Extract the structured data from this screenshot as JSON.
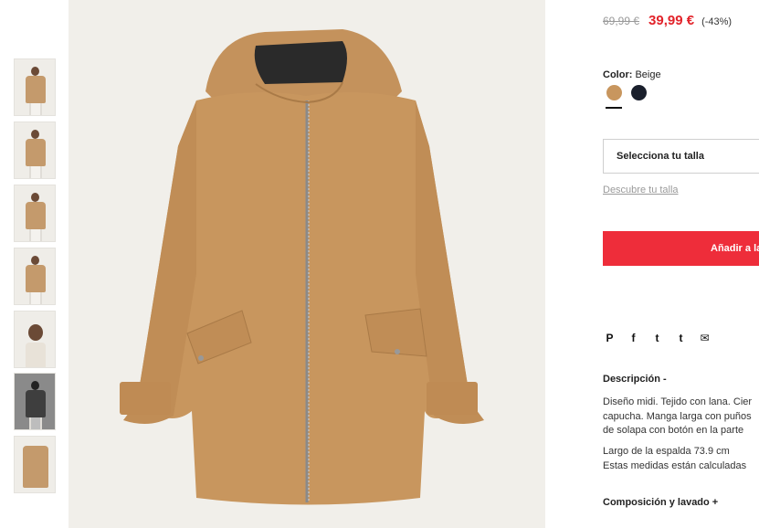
{
  "thumbnails": [
    {
      "alt": "thumb-1"
    },
    {
      "alt": "thumb-2"
    },
    {
      "alt": "thumb-3"
    },
    {
      "alt": "thumb-4"
    },
    {
      "alt": "thumb-5"
    },
    {
      "alt": "thumb-6"
    },
    {
      "alt": "thumb-7"
    }
  ],
  "price": {
    "old": "69,99 €",
    "new": "39,99 €",
    "discount": "(-43%)"
  },
  "color": {
    "label": "Color:",
    "value": "Beige",
    "swatches": [
      {
        "name": "beige",
        "hex": "#c8965e",
        "selected": true
      },
      {
        "name": "navy",
        "hex": "#1a1f2c",
        "selected": false
      }
    ]
  },
  "size": {
    "select_label": "Selecciona tu talla",
    "guide_link": "Descubre tu talla"
  },
  "cart": {
    "add_label": "Añadir a la"
  },
  "share": {
    "pinterest": "P",
    "facebook": "f",
    "twitter": "t",
    "tumblr": "t",
    "email": "✉"
  },
  "description": {
    "title": "Descripción -",
    "lines": [
      "Diseño midi. Tejido con lana. Cier",
      "capucha. Manga larga con puños",
      "de solapa con botón en la parte"
    ],
    "lines2": [
      "Largo de la espalda 73.9 cm",
      "Estas medidas están calculadas"
    ]
  },
  "composition": {
    "title": "Composición y lavado +"
  },
  "colors": {
    "accent": "#ee2d3a",
    "price_red": "#e2232a",
    "coat": "#c8965e"
  }
}
